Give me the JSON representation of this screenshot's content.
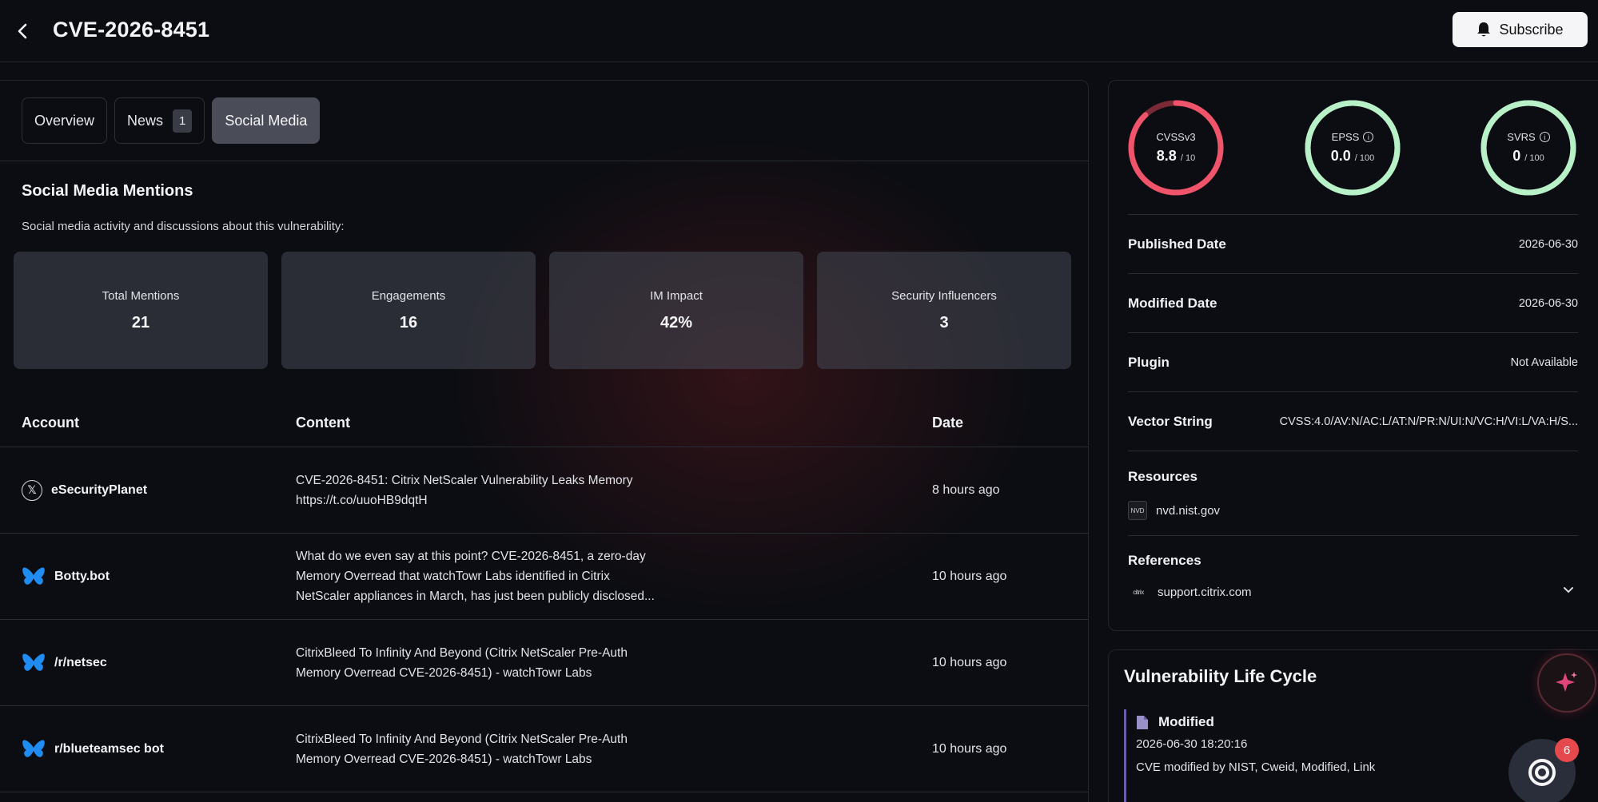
{
  "header": {
    "title": "CVE-2026-8451",
    "subscribe_label": "Subscribe"
  },
  "tabs": [
    {
      "label": "Overview"
    },
    {
      "label": "News",
      "count": "1"
    },
    {
      "label": "Social Media"
    }
  ],
  "section": {
    "title": "Social Media Mentions",
    "subtitle": "Social media activity and discussions about this vulnerability:"
  },
  "stats": [
    {
      "label": "Total Mentions",
      "value": "21"
    },
    {
      "label": "Engagements",
      "value": "16"
    },
    {
      "label": "IM Impact",
      "value": "42%"
    },
    {
      "label": "Security Influencers",
      "value": "3"
    }
  ],
  "table": {
    "headers": {
      "account": "Account",
      "content": "Content",
      "date": "Date"
    },
    "rows": [
      {
        "account": "eSecurityPlanet",
        "platform": "x-icon",
        "content_line1": "CVE-2026-8451: Citrix NetScaler Vulnerability Leaks Memory",
        "content_line2": "https://t.co/uuoHB9dqtH",
        "content_line3": "",
        "date": "8 hours ago"
      },
      {
        "account": "Botty.bot",
        "platform": "bluesky-icon",
        "content_line1": "What do we even say at this point? CVE-2026-8451, a zero-day",
        "content_line2": "Memory Overread that watchTowr Labs identified in Citrix",
        "content_line3": "NetScaler appliances in March, has just been publicly disclosed...",
        "date": "10 hours ago"
      },
      {
        "account": "/r/netsec",
        "platform": "bluesky-icon",
        "content_line1": "CitrixBleed To Infinity And Beyond (Citrix NetScaler Pre-Auth",
        "content_line2": "Memory Overread CVE-2026-8451) - watchTowr Labs",
        "content_line3": "",
        "date": "10 hours ago"
      },
      {
        "account": "r/blueteamsec bot",
        "platform": "bluesky-icon",
        "content_line1": "CitrixBleed To Infinity And Beyond (Citrix NetScaler Pre-Auth",
        "content_line2": "Memory Overread CVE-2026-8451) - watchTowr Labs",
        "content_line3": "",
        "date": "10 hours ago"
      }
    ]
  },
  "scores": [
    {
      "label": "CVSSv3",
      "value": "8.8",
      "max": "/ 10",
      "fraction": 0.88,
      "color": "#f0546a",
      "track": "#7a2a36",
      "info": false
    },
    {
      "label": "EPSS",
      "value": "0.0",
      "max": "/ 100",
      "fraction": 1.0,
      "color": "#b8f0c8",
      "track": "#b8f0c8",
      "info": true
    },
    {
      "label": "SVRS",
      "value": "0",
      "max": "/ 100",
      "fraction": 1.0,
      "color": "#b8f0c8",
      "track": "#b8f0c8",
      "info": true
    }
  ],
  "details": [
    {
      "key": "Published Date",
      "value": "2026-06-30"
    },
    {
      "key": "Modified Date",
      "value": "2026-06-30"
    },
    {
      "key": "Plugin",
      "value": "Not Available"
    },
    {
      "key": "Vector String",
      "value": "CVSS:4.0/AV:N/AC:L/AT:N/PR:N/UI:N/VC:H/VI:L/VA:H/S..."
    }
  ],
  "resources": {
    "title": "Resources",
    "items": [
      {
        "label": "nvd.nist.gov"
      }
    ]
  },
  "references": {
    "title": "References",
    "items": [
      {
        "label": "support.citrix.com"
      }
    ]
  },
  "lifecycle": {
    "title": "Vulnerability Life Cycle",
    "event": {
      "name": "Modified",
      "time": "2026-06-30 18:20:16",
      "description": "CVE modified by NIST, Cweid, Modified, Link"
    }
  },
  "chat": {
    "badge": "6"
  }
}
